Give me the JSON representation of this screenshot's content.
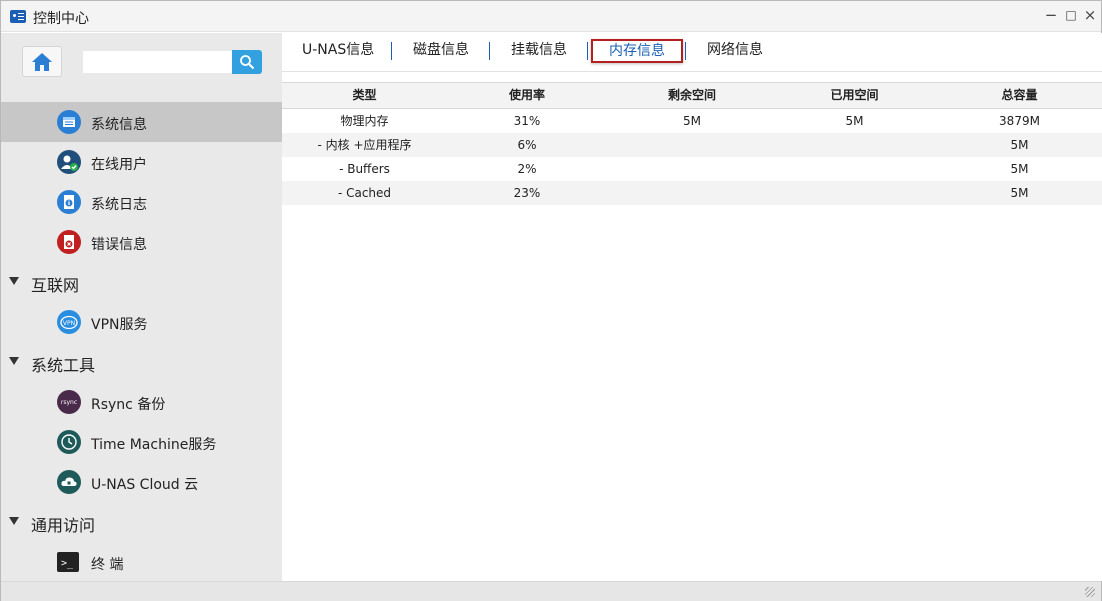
{
  "window": {
    "title": "控制中心",
    "minimize": "−",
    "maximize": "□",
    "close": "×"
  },
  "sidebar": {
    "search": {
      "value": "",
      "placeholder": ""
    },
    "items": [
      {
        "label": "系统信息",
        "icon": "system-info-icon",
        "color": "#2a7fd4",
        "active": true
      },
      {
        "label": "在线用户",
        "icon": "online-user-icon",
        "color": "#1f4f7a"
      },
      {
        "label": "系统日志",
        "icon": "system-log-icon",
        "color": "#2a7fd4"
      },
      {
        "label": "错误信息",
        "icon": "error-info-icon",
        "color": "#c02020"
      }
    ],
    "groups": [
      {
        "label": "互联网",
        "items": [
          {
            "label": "VPN服务",
            "icon": "vpn-icon",
            "color": "#2a8ee0"
          }
        ]
      },
      {
        "label": "系统工具",
        "items": [
          {
            "label": "Rsync 备份",
            "icon": "rsync-icon",
            "color": "#4a2a4a",
            "badge": "rsync"
          },
          {
            "label": "Time Machine服务",
            "icon": "time-machine-icon",
            "color": "#1e5a5a"
          },
          {
            "label": "U-NAS Cloud 云",
            "icon": "cloud-icon",
            "color": "#1e5a5a"
          }
        ]
      },
      {
        "label": "通用访问",
        "items": [
          {
            "label": "终 端",
            "icon": "terminal-icon",
            "color": "#222222",
            "glyph": ">_"
          }
        ]
      }
    ]
  },
  "tabs": [
    {
      "label": "U-NAS信息"
    },
    {
      "label": "磁盘信息"
    },
    {
      "label": "挂载信息"
    },
    {
      "label": "内存信息",
      "active": true
    },
    {
      "label": "网络信息"
    }
  ],
  "memory_table": {
    "columns": [
      "类型",
      "使用率",
      "剩余空间",
      "已用空间",
      "总容量"
    ],
    "rows": [
      [
        "物理内存",
        "31%",
        "5M",
        "5M",
        "3879M"
      ],
      [
        "- 内核 +应用程序",
        "6%",
        "",
        "",
        "5M"
      ],
      [
        "- Buffers",
        "2%",
        "",
        "",
        "5M"
      ],
      [
        "- Cached",
        "23%",
        "",
        "",
        "5M"
      ]
    ]
  },
  "colors": {
    "accent": "#1a5fb4",
    "active_tab_border": "#b42020",
    "search_button": "#33a1e0",
    "sidebar_bg": "#e9e9e9",
    "sidebar_active": "#c7c7c7"
  }
}
